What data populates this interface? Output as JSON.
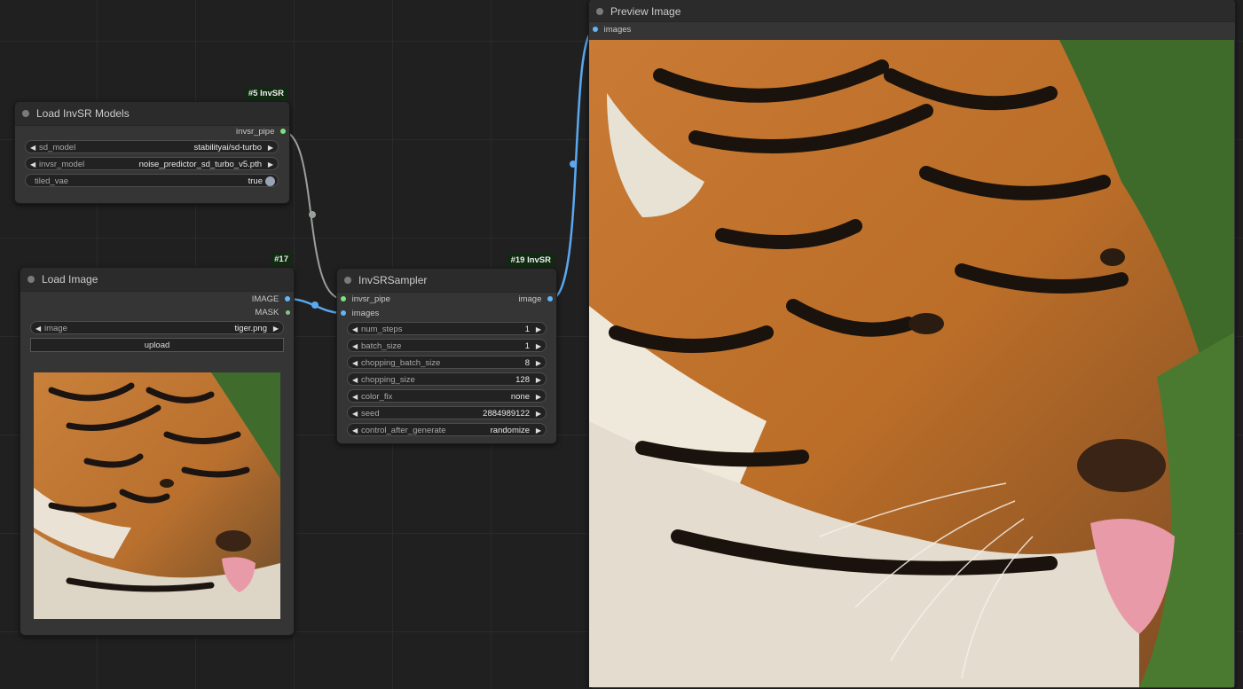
{
  "nodes": {
    "load_models": {
      "title": "Load InvSR Models",
      "badge": "#5 InvSR",
      "output": "invsr_pipe",
      "widgets": [
        {
          "name": "sd_model",
          "value": "stabilityai/sd-turbo"
        },
        {
          "name": "invsr_model",
          "value": "noise_predictor_sd_turbo_v5.pth"
        }
      ],
      "toggle": {
        "name": "tiled_vae",
        "value": "true"
      }
    },
    "load_image": {
      "title": "Load Image",
      "badge": "#17",
      "outputs": [
        "IMAGE",
        "MASK"
      ],
      "widget": {
        "name": "image",
        "value": "tiger.png"
      },
      "upload_label": "upload",
      "preview_icon": "tiger-thumbnail-image"
    },
    "sampler": {
      "title": "InvSRSampler",
      "badge": "#19 InvSR",
      "inputs": [
        "invsr_pipe",
        "images"
      ],
      "output": "image",
      "widgets": [
        {
          "name": "num_steps",
          "value": "1"
        },
        {
          "name": "batch_size",
          "value": "1"
        },
        {
          "name": "chopping_batch_size",
          "value": "8"
        },
        {
          "name": "chopping_size",
          "value": "128"
        },
        {
          "name": "color_fix",
          "value": "none"
        },
        {
          "name": "seed",
          "value": "2884989122"
        },
        {
          "name": "control_after_generate",
          "value": "randomize"
        }
      ]
    },
    "preview": {
      "title": "Preview Image",
      "input": "images",
      "preview_icon": "tiger-upscaled-image"
    }
  },
  "colors": {
    "pipe_slot": "#7ee07e",
    "image_slot": "#64b5f6",
    "mask_slot": "#81c784",
    "pipe_link": "#9aa09a",
    "image_link": "#5aa9f0",
    "canvas": "#202020",
    "node": "#353535",
    "badge": "#0f2a10"
  }
}
